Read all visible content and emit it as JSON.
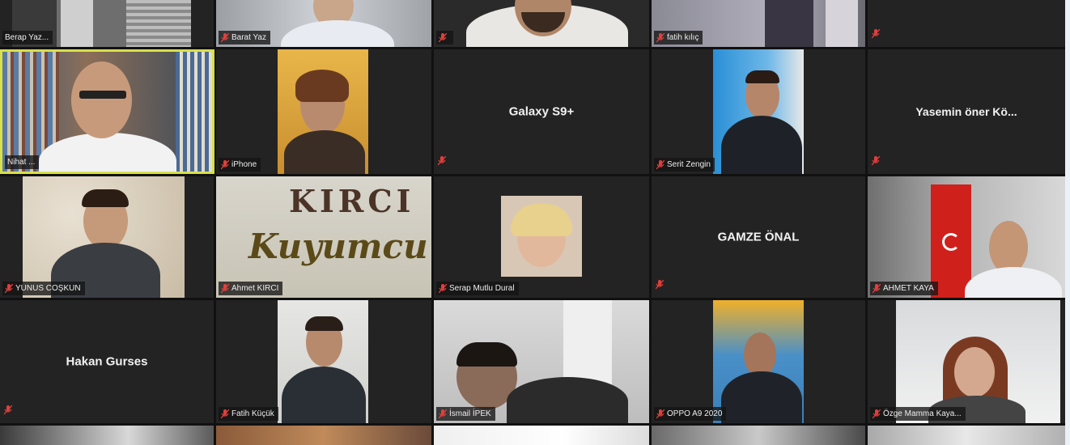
{
  "colors": {
    "tile_bg": "#232323",
    "active_border": "#d8e04a",
    "mic_muted": "#e0403c",
    "name_text": "#f2f2f2"
  },
  "tiles": [
    {
      "name": "Berap Yaz...",
      "type": "video"
    },
    {
      "name": "Barat Yaz",
      "type": "video"
    },
    {
      "name": "",
      "type": "video"
    },
    {
      "name": "fatih kılıç",
      "type": "video"
    },
    {
      "name": "",
      "type": "blank"
    },
    {
      "name": "Nihat ...",
      "type": "video",
      "active": true
    },
    {
      "name": "iPhone",
      "type": "video"
    },
    {
      "name": "Galaxy S9+",
      "type": "name"
    },
    {
      "name": "Serit Zengin",
      "type": "video"
    },
    {
      "name": "Yasemin öner Kö...",
      "type": "name"
    },
    {
      "name": "YUNUS COŞKUN",
      "type": "video"
    },
    {
      "name": "Ahmet KIRCI",
      "type": "video",
      "brand_top": "KIRCI",
      "brand_bottom": "Kuyumcu"
    },
    {
      "name": "Serap Mutlu Dural",
      "type": "video"
    },
    {
      "name": "GAMZE ÖNAL",
      "type": "name"
    },
    {
      "name": "AHMET KAYA",
      "type": "video"
    },
    {
      "name": "Hakan Gurses",
      "type": "name"
    },
    {
      "name": "Fatih Küçük",
      "type": "video"
    },
    {
      "name": "İsmail İPEK",
      "type": "video"
    },
    {
      "name": "OPPO A9 2020",
      "type": "video"
    },
    {
      "name": "Özge Mamma Kaya...",
      "type": "video"
    }
  ]
}
